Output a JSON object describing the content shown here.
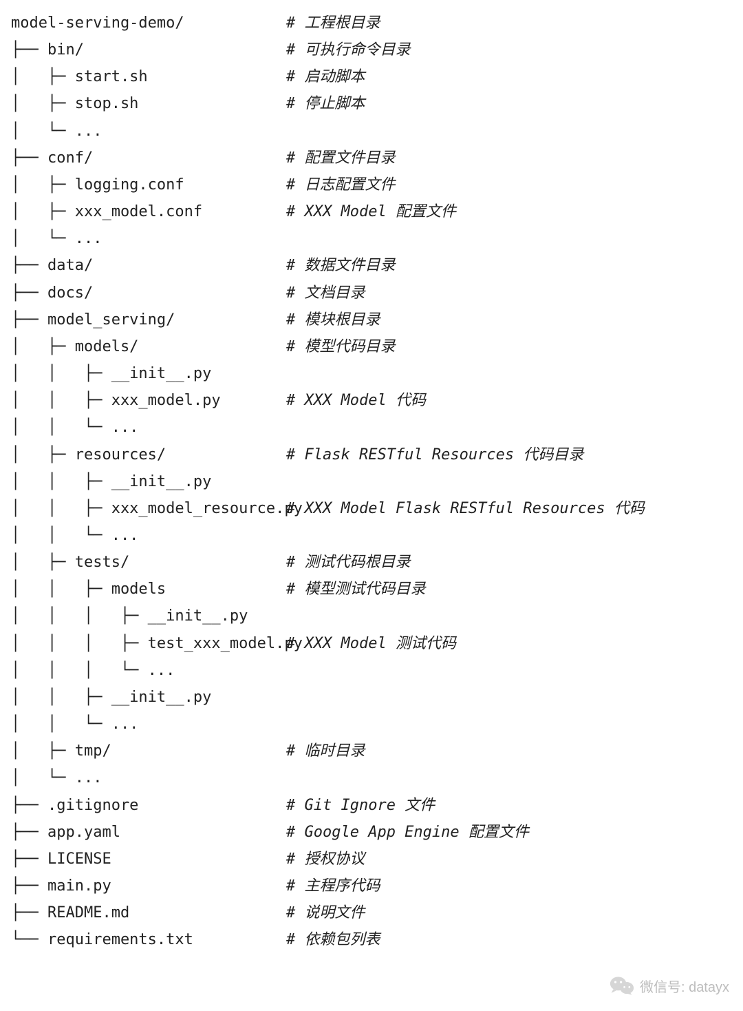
{
  "wechat": {
    "label": "微信号: datayx"
  },
  "rows": [
    {
      "tree": "model-serving-demo/",
      "comment": "# 工程根目录"
    },
    {
      "tree": "├── bin/",
      "comment": "# 可执行命令目录"
    },
    {
      "tree": "│   ├─ start.sh",
      "comment": "# 启动脚本"
    },
    {
      "tree": "│   ├─ stop.sh",
      "comment": "# 停止脚本"
    },
    {
      "tree": "│   └─ ...",
      "comment": ""
    },
    {
      "tree": "├── conf/",
      "comment": "# 配置文件目录"
    },
    {
      "tree": "│   ├─ logging.conf",
      "comment": "# 日志配置文件"
    },
    {
      "tree": "│   ├─ xxx_model.conf",
      "comment": "# XXX Model 配置文件"
    },
    {
      "tree": "│   └─ ...",
      "comment": ""
    },
    {
      "tree": "├── data/",
      "comment": "# 数据文件目录"
    },
    {
      "tree": "├── docs/",
      "comment": "# 文档目录"
    },
    {
      "tree": "├── model_serving/",
      "comment": "# 模块根目录"
    },
    {
      "tree": "│   ├─ models/",
      "comment": "# 模型代码目录"
    },
    {
      "tree": "│   │   ├─ __init__.py",
      "comment": ""
    },
    {
      "tree": "│   │   ├─ xxx_model.py",
      "comment": "# XXX Model 代码"
    },
    {
      "tree": "│   │   └─ ...",
      "comment": ""
    },
    {
      "tree": "│   ├─ resources/",
      "comment": "# Flask RESTful Resources 代码目录"
    },
    {
      "tree": "│   │   ├─ __init__.py",
      "comment": ""
    },
    {
      "tree": "│   │   ├─ xxx_model_resource.py",
      "comment": "# XXX Model Flask RESTful Resources 代码"
    },
    {
      "tree": "│   │   └─ ...",
      "comment": ""
    },
    {
      "tree": "│   ├─ tests/",
      "comment": "# 测试代码根目录"
    },
    {
      "tree": "│   │   ├─ models",
      "comment": "# 模型测试代码目录"
    },
    {
      "tree": "│   │   │   ├─ __init__.py",
      "comment": ""
    },
    {
      "tree": "│   │   │   ├─ test_xxx_model.py",
      "comment": "# XXX Model 测试代码"
    },
    {
      "tree": "│   │   │   └─ ...",
      "comment": ""
    },
    {
      "tree": "│   │   ├─ __init__.py",
      "comment": ""
    },
    {
      "tree": "│   │   └─ ...",
      "comment": ""
    },
    {
      "tree": "│   ├─ tmp/",
      "comment": "# 临时目录"
    },
    {
      "tree": "│   └─ ...",
      "comment": ""
    },
    {
      "tree": "├── .gitignore",
      "comment": "# Git Ignore 文件"
    },
    {
      "tree": "├── app.yaml",
      "comment": "# Google App Engine 配置文件"
    },
    {
      "tree": "├── LICENSE",
      "comment": "# 授权协议"
    },
    {
      "tree": "├── main.py",
      "comment": "# 主程序代码"
    },
    {
      "tree": "├── README.md",
      "comment": "# 说明文件"
    },
    {
      "tree": "└── requirements.txt",
      "comment": "# 依赖包列表"
    }
  ]
}
